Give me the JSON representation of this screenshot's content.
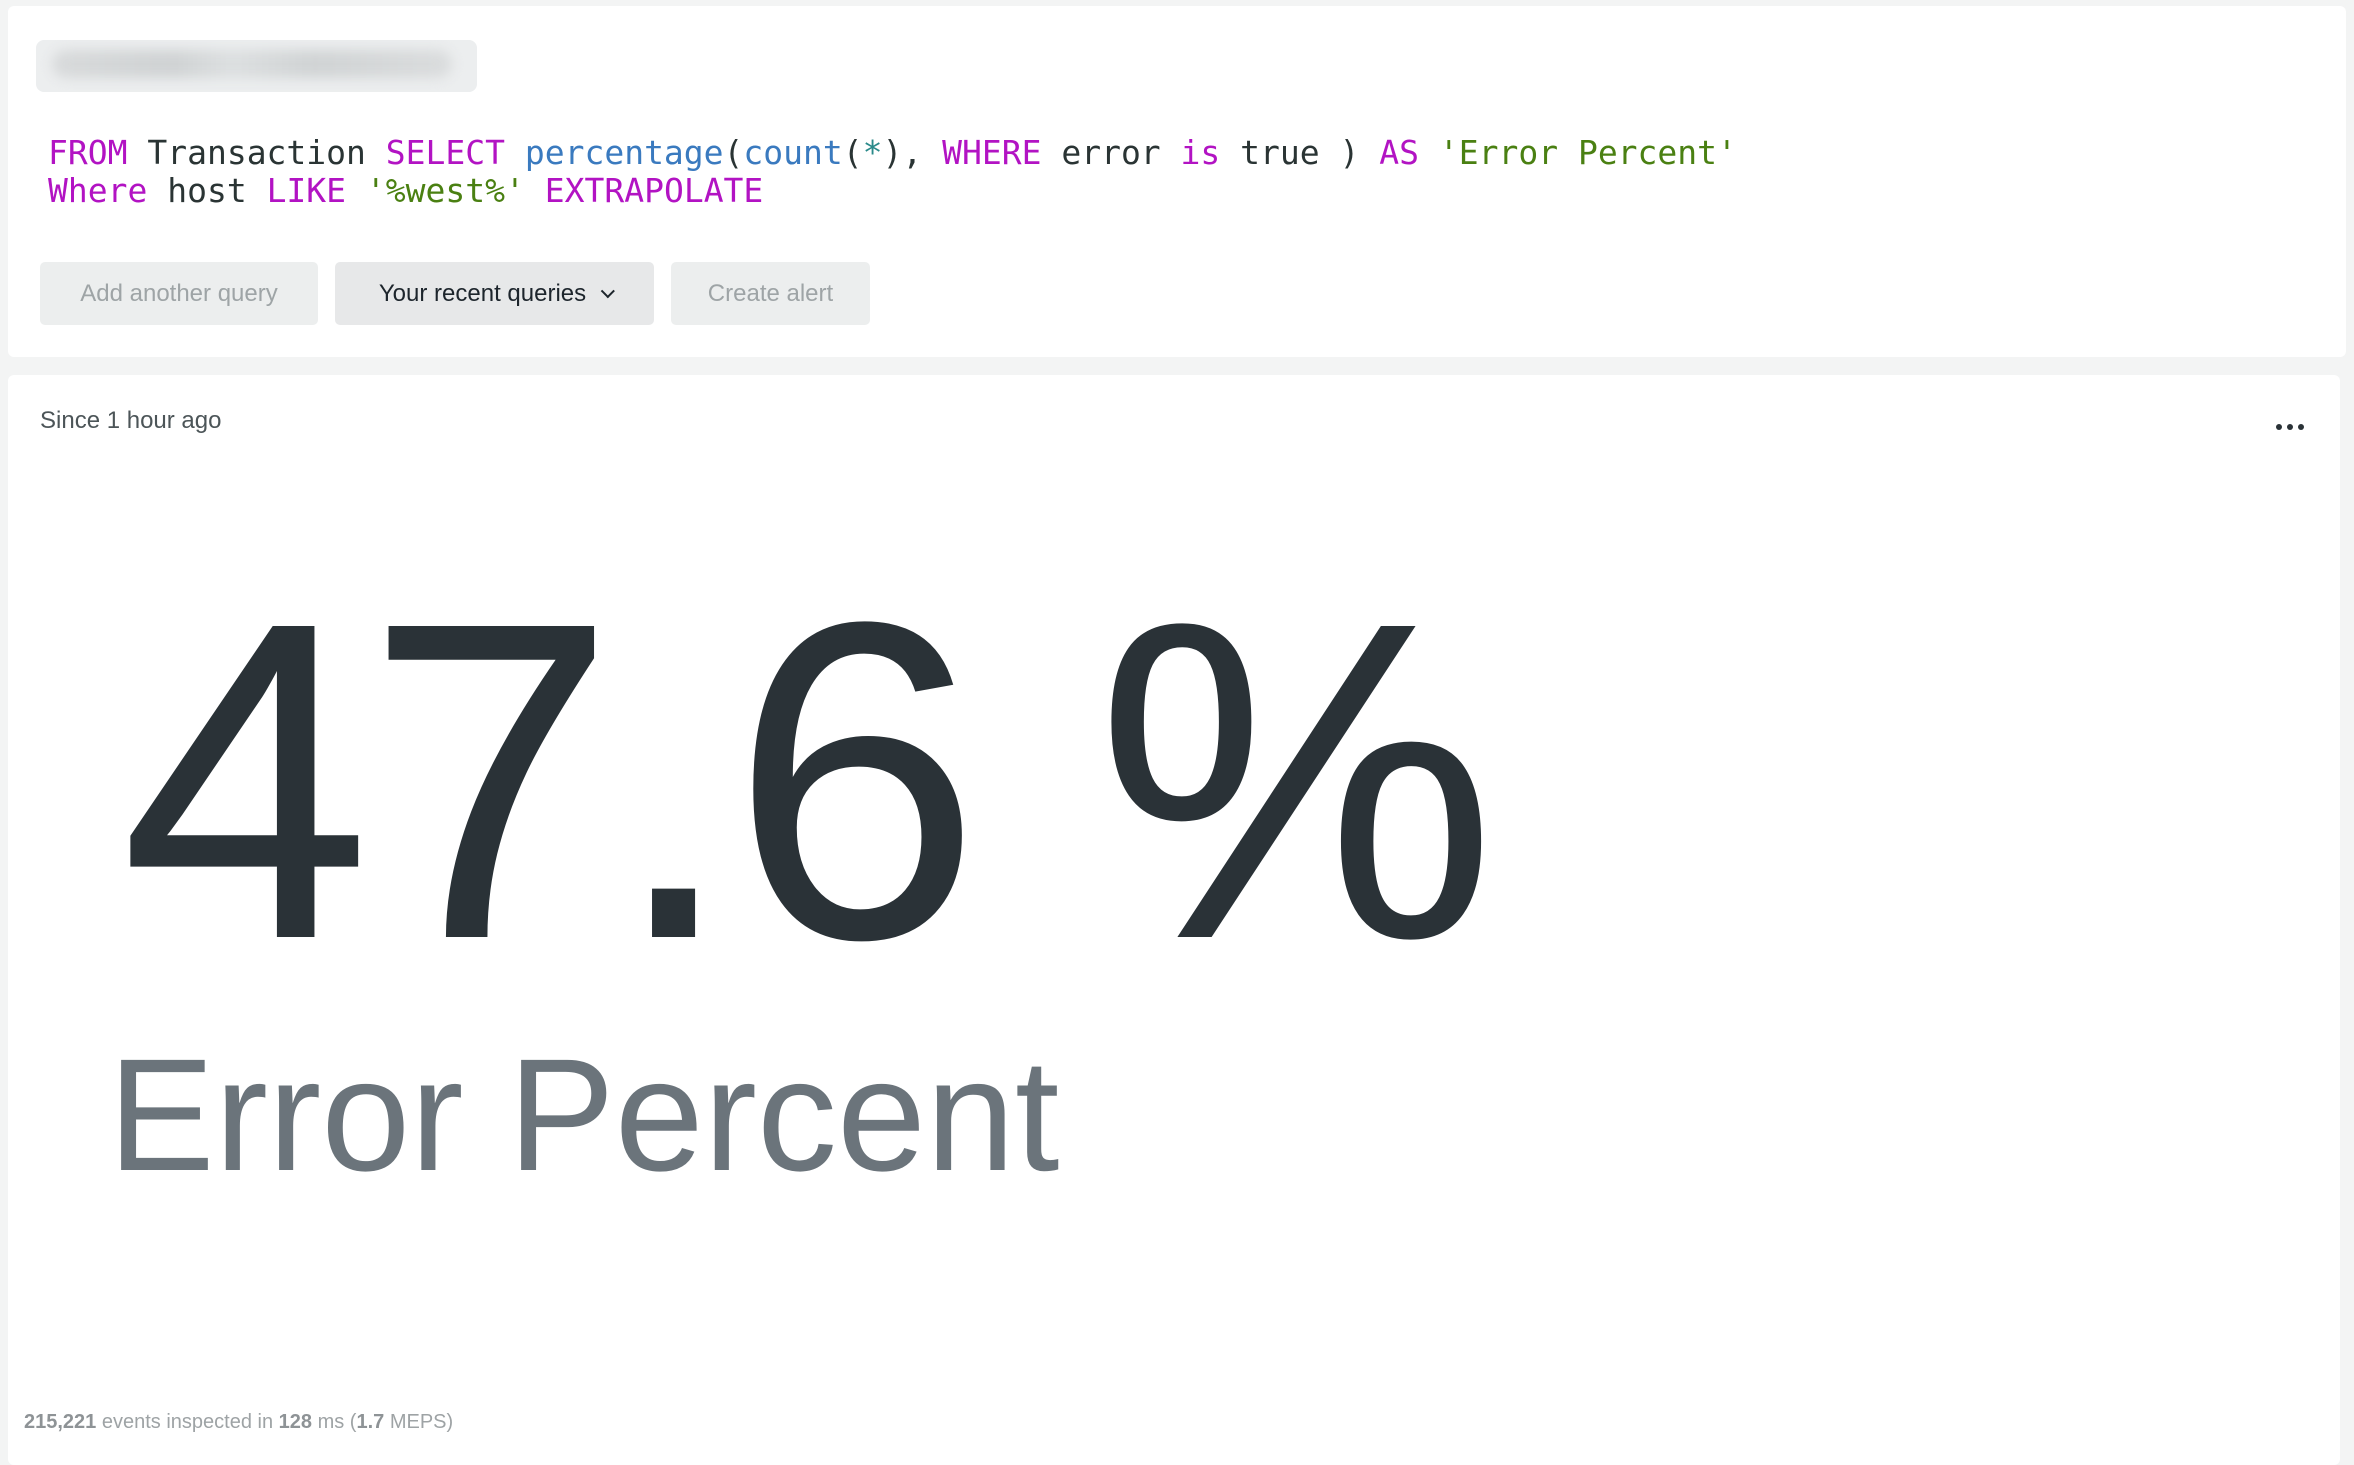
{
  "query_card": {
    "title_redacted": true,
    "query_lines": [
      [
        {
          "t": "FROM",
          "c": "kw"
        },
        {
          "t": " Transaction ",
          "c": ""
        },
        {
          "t": "SELECT",
          "c": "kw"
        },
        {
          "t": " ",
          "c": ""
        },
        {
          "t": "percentage",
          "c": "fn"
        },
        {
          "t": "(",
          "c": ""
        },
        {
          "t": "count",
          "c": "fn"
        },
        {
          "t": "(",
          "c": ""
        },
        {
          "t": "*",
          "c": "op"
        },
        {
          "t": "), ",
          "c": ""
        },
        {
          "t": "WHERE",
          "c": "kw"
        },
        {
          "t": " error ",
          "c": ""
        },
        {
          "t": "is",
          "c": "kw"
        },
        {
          "t": " true ) ",
          "c": ""
        },
        {
          "t": "AS",
          "c": "kw"
        },
        {
          "t": " ",
          "c": ""
        },
        {
          "t": "'Error Percent'",
          "c": "str"
        }
      ],
      [
        {
          "t": "Where",
          "c": "kw"
        },
        {
          "t": " host ",
          "c": ""
        },
        {
          "t": "LIKE",
          "c": "kw"
        },
        {
          "t": " ",
          "c": ""
        },
        {
          "t": "'%west%'",
          "c": "str"
        },
        {
          "t": " ",
          "c": ""
        },
        {
          "t": "EXTRAPOLATE",
          "c": "kw"
        }
      ]
    ],
    "buttons": {
      "add_query": "Add another query",
      "recent_queries": "Your recent queries",
      "create_alert": "Create alert"
    }
  },
  "result_card": {
    "time_range": "Since 1 hour ago",
    "more_menu_icon": "ellipsis-icon",
    "value": "47.6 %",
    "label": "Error Percent",
    "footer": {
      "events": "215,221",
      "events_text": " events inspected in ",
      "duration": "128",
      "duration_text": " ms (",
      "rate": "1.7",
      "rate_text": " MEPS)"
    }
  },
  "colors": {
    "keyword": "#b213c3",
    "function": "#3a7abf",
    "string": "#4a8012",
    "value_text": "#2a3237",
    "label_text": "#6b747b"
  }
}
